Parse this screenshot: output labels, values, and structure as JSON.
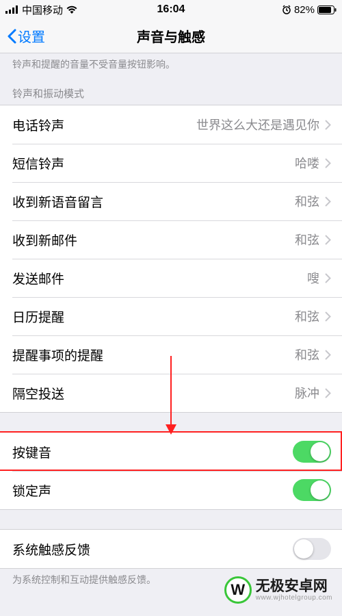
{
  "status": {
    "carrier": "中国移动",
    "time": "16:04",
    "battery": "82%"
  },
  "nav": {
    "back": "设置",
    "title": "声音与触感"
  },
  "header_note": "铃声和提醒的音量不受音量按钮影响。",
  "section1_header": "铃声和振动模式",
  "rows": [
    {
      "label": "电话铃声",
      "value": "世界这么大还是遇见你"
    },
    {
      "label": "短信铃声",
      "value": "哈喽"
    },
    {
      "label": "收到新语音留言",
      "value": "和弦"
    },
    {
      "label": "收到新邮件",
      "value": "和弦"
    },
    {
      "label": "发送邮件",
      "value": "嗖"
    },
    {
      "label": "日历提醒",
      "value": "和弦"
    },
    {
      "label": "提醒事项的提醒",
      "value": "和弦"
    },
    {
      "label": "隔空投送",
      "value": "脉冲"
    }
  ],
  "switches": {
    "keyboard": {
      "label": "按键音",
      "on": true
    },
    "lock": {
      "label": "锁定声",
      "on": true
    }
  },
  "haptic": {
    "label": "系统触感反馈",
    "on": false
  },
  "footer": "为系统控制和互动提供触感反馈。",
  "watermark": {
    "line1": "无极安卓网",
    "line2": "www.wjhotelgroup.com"
  }
}
